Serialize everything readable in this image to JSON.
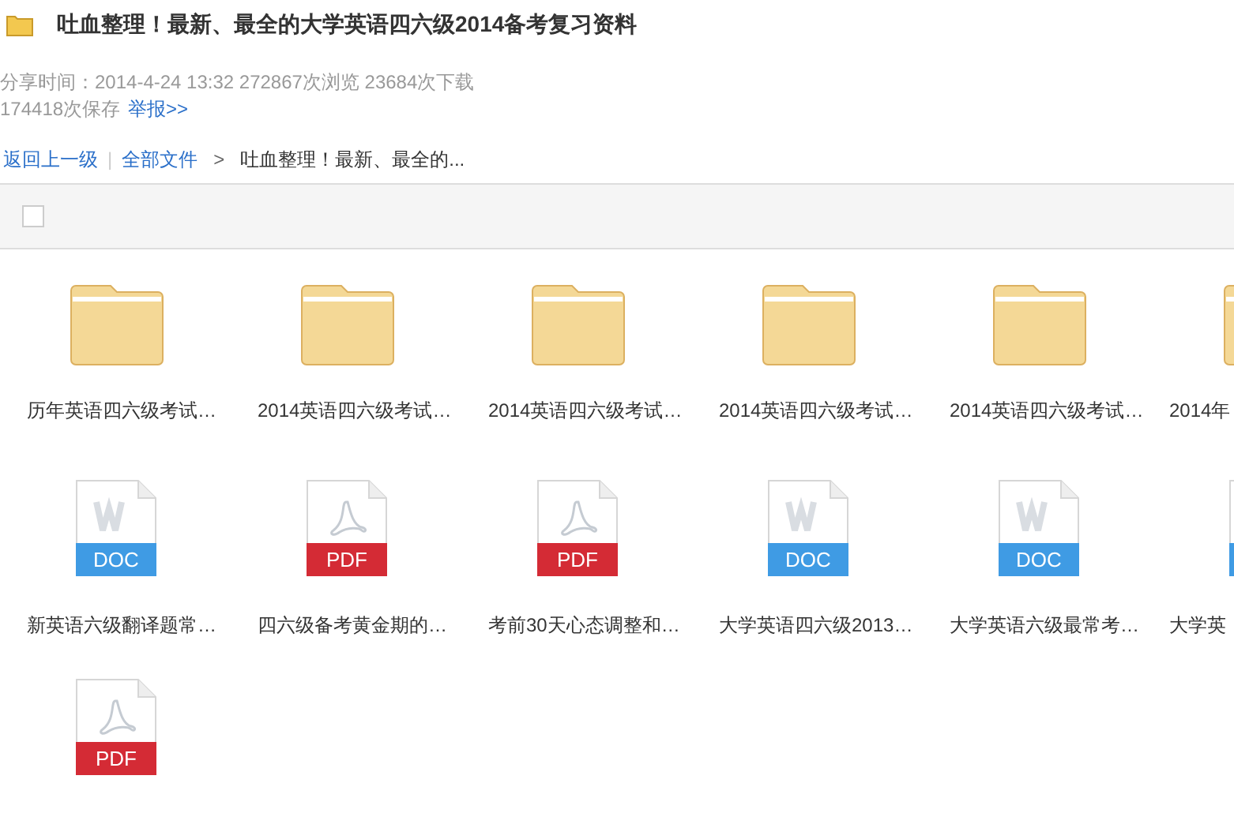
{
  "header": {
    "title": "吐血整理！最新、最全的大学英语四六级2014备考复习资料",
    "meta_line": "分享时间：2014-4-24 13:32 272867次浏览 23684次下载",
    "saves": "174418次保存",
    "report_link": "举报>>"
  },
  "breadcrumb": {
    "back_link": "返回上一级",
    "separator": "|",
    "root_link": "全部文件",
    "arrow": ">",
    "current": "吐血整理！最新、最全的..."
  },
  "toolbar": {
    "select_all_checked": false
  },
  "files": [
    {
      "kind": "folder",
      "label": "历年英语四六级考试…"
    },
    {
      "kind": "folder",
      "label": "2014英语四六级考试…"
    },
    {
      "kind": "folder",
      "label": "2014英语四六级考试…"
    },
    {
      "kind": "folder",
      "label": "2014英语四六级考试…"
    },
    {
      "kind": "folder",
      "label": "2014英语四六级考试…"
    },
    {
      "kind": "folder",
      "label": "2014年"
    },
    {
      "kind": "doc",
      "label": "新英语六级翻译题常…",
      "badge": "DOC"
    },
    {
      "kind": "pdf",
      "label": "四六级备考黄金期的…",
      "badge": "PDF"
    },
    {
      "kind": "pdf",
      "label": "考前30天心态调整和…",
      "badge": "PDF"
    },
    {
      "kind": "doc",
      "label": "大学英语四六级2013…",
      "badge": "DOC"
    },
    {
      "kind": "doc",
      "label": "大学英语六级最常考…",
      "badge": "DOC"
    },
    {
      "kind": "doc",
      "label": "大学英"
    },
    {
      "kind": "pdf",
      "badge": "PDF"
    }
  ]
}
